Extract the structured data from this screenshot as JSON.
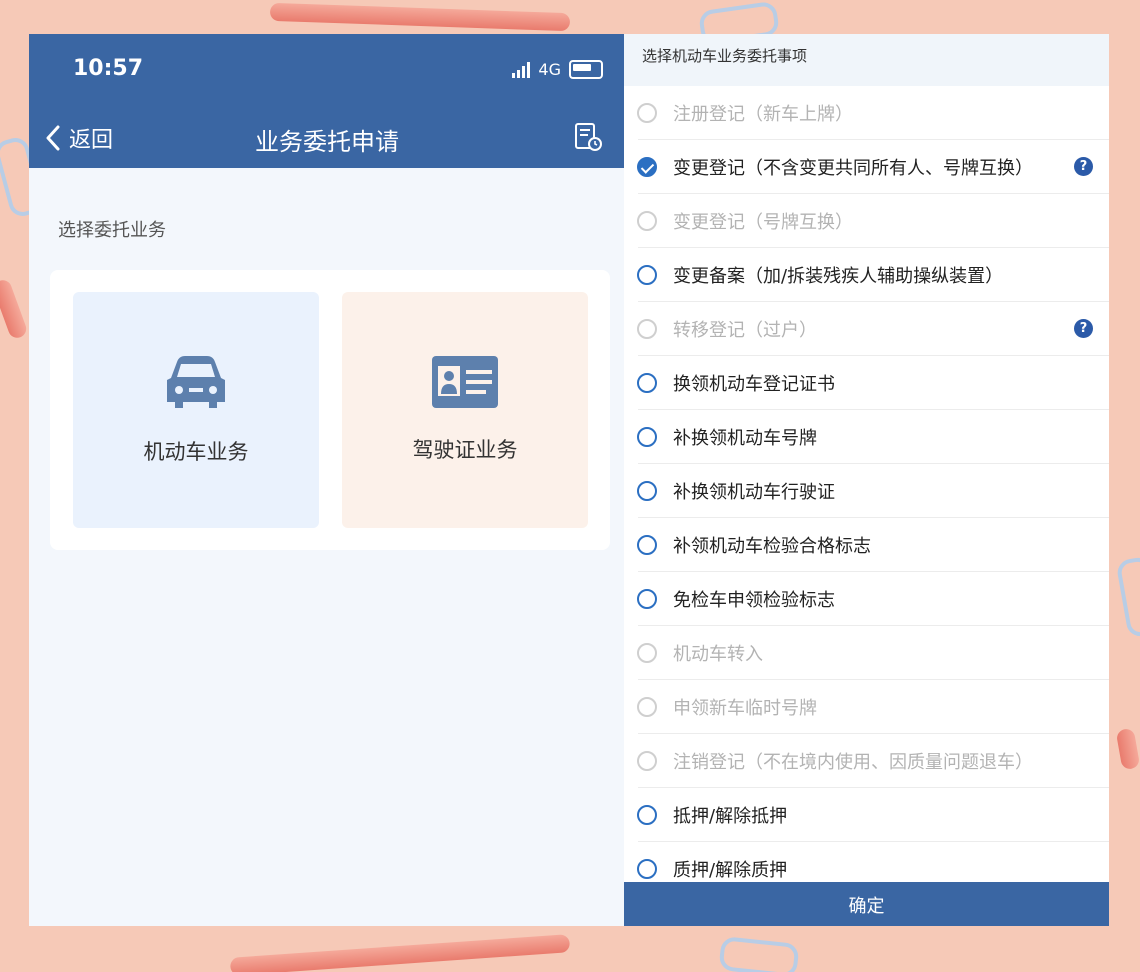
{
  "status": {
    "time": "10:57",
    "network": "4G"
  },
  "nav": {
    "back_label": "返回",
    "title": "业务委托申请"
  },
  "left": {
    "section_label": "选择委托业务",
    "tiles": [
      {
        "label": "机动车业务",
        "icon": "car-icon"
      },
      {
        "label": "驾驶证业务",
        "icon": "id-card-icon"
      }
    ]
  },
  "panel": {
    "title": "选择机动车业务委托事项",
    "options": [
      {
        "label": "注册登记（新车上牌）",
        "disabled": true,
        "checked": false,
        "help": false
      },
      {
        "label": "变更登记（不含变更共同所有人、号牌互换）",
        "disabled": false,
        "checked": true,
        "help": true
      },
      {
        "label": "变更登记（号牌互换）",
        "disabled": true,
        "checked": false,
        "help": false
      },
      {
        "label": "变更备案（加/拆装残疾人辅助操纵装置）",
        "disabled": false,
        "checked": false,
        "help": false
      },
      {
        "label": "转移登记（过户）",
        "disabled": true,
        "checked": false,
        "help": true
      },
      {
        "label": "换领机动车登记证书",
        "disabled": false,
        "checked": false,
        "help": false
      },
      {
        "label": "补换领机动车号牌",
        "disabled": false,
        "checked": false,
        "help": false
      },
      {
        "label": "补换领机动车行驶证",
        "disabled": false,
        "checked": false,
        "help": false
      },
      {
        "label": "补领机动车检验合格标志",
        "disabled": false,
        "checked": false,
        "help": false
      },
      {
        "label": "免检车申领检验标志",
        "disabled": false,
        "checked": false,
        "help": false
      },
      {
        "label": "机动车转入",
        "disabled": true,
        "checked": false,
        "help": false
      },
      {
        "label": "申领新车临时号牌",
        "disabled": true,
        "checked": false,
        "help": false
      },
      {
        "label": "注销登记（不在境内使用、因质量问题退车）",
        "disabled": true,
        "checked": false,
        "help": false
      },
      {
        "label": "抵押/解除抵押",
        "disabled": false,
        "checked": false,
        "help": false
      },
      {
        "label": "质押/解除质押",
        "disabled": false,
        "checked": false,
        "help": false
      }
    ],
    "help_glyph": "?",
    "confirm_label": "确定"
  },
  "colors": {
    "primary": "#3a66a3",
    "radio": "#2b6fc2",
    "background": "#f6c9b7"
  }
}
